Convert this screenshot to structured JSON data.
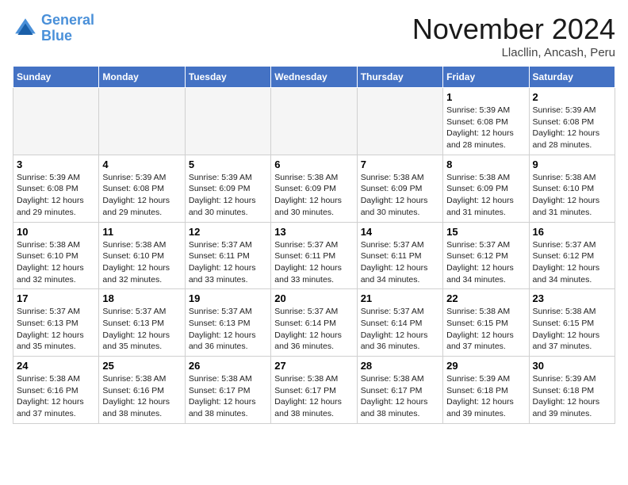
{
  "header": {
    "logo_line1": "General",
    "logo_line2": "Blue",
    "month_title": "November 2024",
    "location": "Llacllin, Ancash, Peru"
  },
  "weekdays": [
    "Sunday",
    "Monday",
    "Tuesday",
    "Wednesday",
    "Thursday",
    "Friday",
    "Saturday"
  ],
  "weeks": [
    [
      {
        "day": "",
        "info": ""
      },
      {
        "day": "",
        "info": ""
      },
      {
        "day": "",
        "info": ""
      },
      {
        "day": "",
        "info": ""
      },
      {
        "day": "",
        "info": ""
      },
      {
        "day": "1",
        "info": "Sunrise: 5:39 AM\nSunset: 6:08 PM\nDaylight: 12 hours and 28 minutes."
      },
      {
        "day": "2",
        "info": "Sunrise: 5:39 AM\nSunset: 6:08 PM\nDaylight: 12 hours and 28 minutes."
      }
    ],
    [
      {
        "day": "3",
        "info": "Sunrise: 5:39 AM\nSunset: 6:08 PM\nDaylight: 12 hours and 29 minutes."
      },
      {
        "day": "4",
        "info": "Sunrise: 5:39 AM\nSunset: 6:08 PM\nDaylight: 12 hours and 29 minutes."
      },
      {
        "day": "5",
        "info": "Sunrise: 5:39 AM\nSunset: 6:09 PM\nDaylight: 12 hours and 30 minutes."
      },
      {
        "day": "6",
        "info": "Sunrise: 5:38 AM\nSunset: 6:09 PM\nDaylight: 12 hours and 30 minutes."
      },
      {
        "day": "7",
        "info": "Sunrise: 5:38 AM\nSunset: 6:09 PM\nDaylight: 12 hours and 30 minutes."
      },
      {
        "day": "8",
        "info": "Sunrise: 5:38 AM\nSunset: 6:09 PM\nDaylight: 12 hours and 31 minutes."
      },
      {
        "day": "9",
        "info": "Sunrise: 5:38 AM\nSunset: 6:10 PM\nDaylight: 12 hours and 31 minutes."
      }
    ],
    [
      {
        "day": "10",
        "info": "Sunrise: 5:38 AM\nSunset: 6:10 PM\nDaylight: 12 hours and 32 minutes."
      },
      {
        "day": "11",
        "info": "Sunrise: 5:38 AM\nSunset: 6:10 PM\nDaylight: 12 hours and 32 minutes."
      },
      {
        "day": "12",
        "info": "Sunrise: 5:37 AM\nSunset: 6:11 PM\nDaylight: 12 hours and 33 minutes."
      },
      {
        "day": "13",
        "info": "Sunrise: 5:37 AM\nSunset: 6:11 PM\nDaylight: 12 hours and 33 minutes."
      },
      {
        "day": "14",
        "info": "Sunrise: 5:37 AM\nSunset: 6:11 PM\nDaylight: 12 hours and 34 minutes."
      },
      {
        "day": "15",
        "info": "Sunrise: 5:37 AM\nSunset: 6:12 PM\nDaylight: 12 hours and 34 minutes."
      },
      {
        "day": "16",
        "info": "Sunrise: 5:37 AM\nSunset: 6:12 PM\nDaylight: 12 hours and 34 minutes."
      }
    ],
    [
      {
        "day": "17",
        "info": "Sunrise: 5:37 AM\nSunset: 6:13 PM\nDaylight: 12 hours and 35 minutes."
      },
      {
        "day": "18",
        "info": "Sunrise: 5:37 AM\nSunset: 6:13 PM\nDaylight: 12 hours and 35 minutes."
      },
      {
        "day": "19",
        "info": "Sunrise: 5:37 AM\nSunset: 6:13 PM\nDaylight: 12 hours and 36 minutes."
      },
      {
        "day": "20",
        "info": "Sunrise: 5:37 AM\nSunset: 6:14 PM\nDaylight: 12 hours and 36 minutes."
      },
      {
        "day": "21",
        "info": "Sunrise: 5:37 AM\nSunset: 6:14 PM\nDaylight: 12 hours and 36 minutes."
      },
      {
        "day": "22",
        "info": "Sunrise: 5:38 AM\nSunset: 6:15 PM\nDaylight: 12 hours and 37 minutes."
      },
      {
        "day": "23",
        "info": "Sunrise: 5:38 AM\nSunset: 6:15 PM\nDaylight: 12 hours and 37 minutes."
      }
    ],
    [
      {
        "day": "24",
        "info": "Sunrise: 5:38 AM\nSunset: 6:16 PM\nDaylight: 12 hours and 37 minutes."
      },
      {
        "day": "25",
        "info": "Sunrise: 5:38 AM\nSunset: 6:16 PM\nDaylight: 12 hours and 38 minutes."
      },
      {
        "day": "26",
        "info": "Sunrise: 5:38 AM\nSunset: 6:17 PM\nDaylight: 12 hours and 38 minutes."
      },
      {
        "day": "27",
        "info": "Sunrise: 5:38 AM\nSunset: 6:17 PM\nDaylight: 12 hours and 38 minutes."
      },
      {
        "day": "28",
        "info": "Sunrise: 5:38 AM\nSunset: 6:17 PM\nDaylight: 12 hours and 38 minutes."
      },
      {
        "day": "29",
        "info": "Sunrise: 5:39 AM\nSunset: 6:18 PM\nDaylight: 12 hours and 39 minutes."
      },
      {
        "day": "30",
        "info": "Sunrise: 5:39 AM\nSunset: 6:18 PM\nDaylight: 12 hours and 39 minutes."
      }
    ]
  ]
}
